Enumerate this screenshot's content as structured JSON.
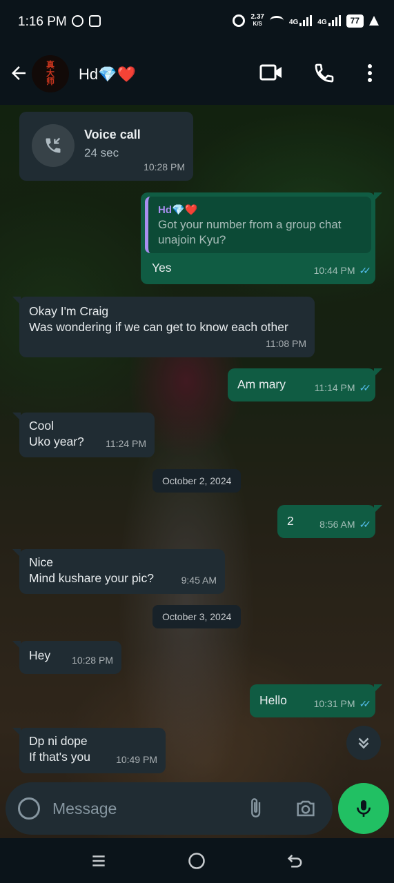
{
  "status_bar": {
    "time": "1:16 PM",
    "speed_value": "2.37",
    "speed_unit": "K/S",
    "network_1": "4G",
    "network_2": "4G",
    "battery": "77"
  },
  "header": {
    "contact_name": "Hd💎❤️"
  },
  "messages": [
    {
      "type": "call",
      "title": "Voice call",
      "duration": "24 sec",
      "time": "10:28 PM"
    },
    {
      "type": "out",
      "quote_author": "Hd💎❤️",
      "quote_text": "Got your number from a group chat unajoin Kyu?",
      "text": "Yes",
      "time": "10:44 PM"
    },
    {
      "type": "in",
      "text": "Okay I'm Craig\nWas wondering if we can get to know each other",
      "time": "11:08 PM"
    },
    {
      "type": "out",
      "text": "Am mary",
      "time": "11:14 PM"
    },
    {
      "type": "in",
      "text": "Cool\nUko year?",
      "time": "11:24 PM"
    },
    {
      "type": "date",
      "text": "October 2, 2024"
    },
    {
      "type": "out",
      "text": "2",
      "time": "8:56 AM"
    },
    {
      "type": "in",
      "text": "Nice\nMind kushare your pic?",
      "time": "9:45 AM"
    },
    {
      "type": "date",
      "text": "October 3, 2024"
    },
    {
      "type": "in",
      "text": "Hey",
      "time": "10:28 PM"
    },
    {
      "type": "out",
      "text": "Hello",
      "time": "10:31 PM"
    },
    {
      "type": "in",
      "text": "Dp ni dope\nIf that's you",
      "time": "10:49 PM"
    }
  ],
  "composer": {
    "placeholder": "Message"
  },
  "colors": {
    "incoming_bubble": "#202c33",
    "outgoing_bubble": "#105c43",
    "read_ticks": "#53bdeb",
    "mic_button": "#21c063",
    "quote_bar": "#a98ef0"
  },
  "icons": [
    "back-arrow-icon",
    "video-call-icon",
    "phone-icon",
    "more-options-icon",
    "missed-call-icon",
    "double-check-icon",
    "emoji-icon",
    "attach-icon",
    "camera-icon",
    "mic-icon",
    "scroll-down-icon"
  ]
}
